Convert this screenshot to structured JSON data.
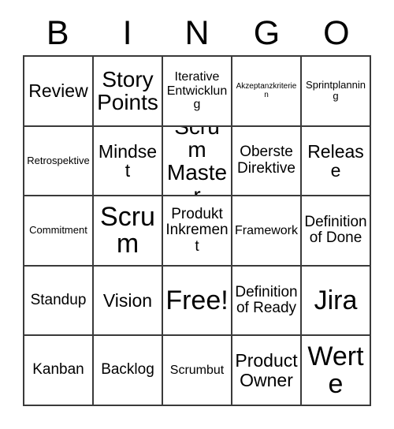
{
  "card": {
    "header_letters": [
      "B",
      "I",
      "N",
      "G",
      "O"
    ],
    "rows": [
      [
        {
          "text": "Review",
          "size": "l"
        },
        {
          "text": "Story Points",
          "size": "xl"
        },
        {
          "text": "Iterative Entwicklung",
          "size": "s"
        },
        {
          "text": "Akzeptanzkriterien",
          "size": "xxs"
        },
        {
          "text": "Sprintplanning",
          "size": "xs"
        }
      ],
      [
        {
          "text": "Retrospektive",
          "size": "xs"
        },
        {
          "text": "Mindset",
          "size": "l"
        },
        {
          "text": "Scrum Master",
          "size": "xl"
        },
        {
          "text": "Oberste Direktive",
          "size": "m"
        },
        {
          "text": "Release",
          "size": "l"
        }
      ],
      [
        {
          "text": "Commitment",
          "size": "xs"
        },
        {
          "text": "Scrum",
          "size": "xxl"
        },
        {
          "text": "Produkt Inkrement",
          "size": "m"
        },
        {
          "text": "Framework",
          "size": "s"
        },
        {
          "text": "Definition of Done",
          "size": "m"
        }
      ],
      [
        {
          "text": "Standup",
          "size": "m"
        },
        {
          "text": "Vision",
          "size": "l"
        },
        {
          "text": "Free!",
          "size": "xxl"
        },
        {
          "text": "Definition of Ready",
          "size": "m"
        },
        {
          "text": "Jira",
          "size": "xxl"
        }
      ],
      [
        {
          "text": "Kanban",
          "size": "m"
        },
        {
          "text": "Backlog",
          "size": "m"
        },
        {
          "text": "Scrumbut",
          "size": "s"
        },
        {
          "text": "Product Owner",
          "size": "l"
        },
        {
          "text": "Werte",
          "size": "xxl"
        }
      ]
    ]
  },
  "colors": {
    "background": "#ffffff",
    "text": "#000000",
    "grid_line": "#3a3a3a"
  }
}
